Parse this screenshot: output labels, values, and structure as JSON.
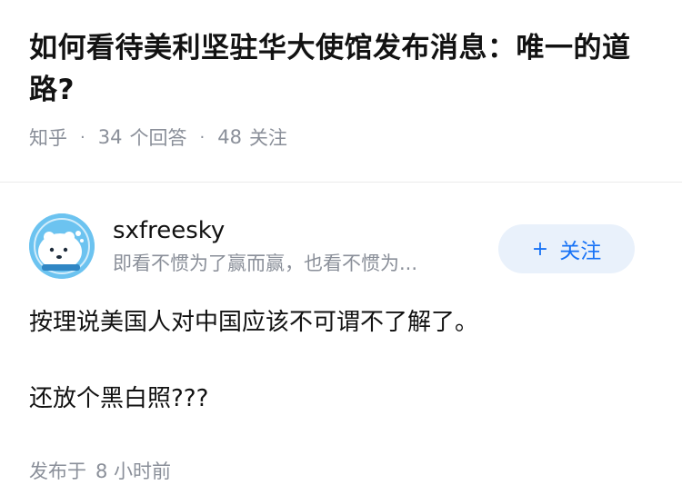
{
  "question": {
    "title": "如何看待美利坚驻华大使馆发布消息：唯一的道路?",
    "source": "知乎",
    "answers_count": "34",
    "answers_label": "个回答",
    "followers_count": "48",
    "followers_label": "关注"
  },
  "answer": {
    "author_name": "sxfreesky",
    "author_bio": "即看不惯为了赢而赢，也看不惯为...",
    "follow_plus": "+",
    "follow_label": "关注",
    "paragraphs": [
      "按理说美国人对中国应该不可谓不了解了。",
      "还放个黑白照???"
    ],
    "published_label": "发布于",
    "published_time": "8 小时前"
  },
  "colors": {
    "accent": "#1772f6",
    "follow_bg": "#e9f1fb",
    "muted": "#8a8f99",
    "avatar_bg": "#6cc3f0"
  }
}
